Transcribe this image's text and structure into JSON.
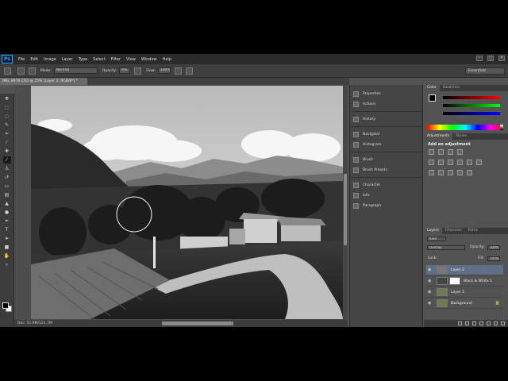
{
  "menubar": {
    "logo": "Ps",
    "items": [
      "File",
      "Edit",
      "Image",
      "Layer",
      "Type",
      "Select",
      "Filter",
      "View",
      "Window",
      "Help"
    ]
  },
  "options": {
    "mode_label": "Mode:",
    "mode_value": "Normal",
    "opacity_label": "Opacity:",
    "opacity_value": "6%",
    "flow_label": "Flow:",
    "flow_value": "100%",
    "workspace": "Essentials"
  },
  "document": {
    "tab_title": "IMG_8976.CR2 @ 25% (Layer 2, RGB/8*) *",
    "status": "Doc: 51.9M/121.7M"
  },
  "tools": [
    "move-icon",
    "marquee-icon",
    "lasso-icon",
    "quick-select-icon",
    "crop-icon",
    "eyedropper-icon",
    "healing-icon",
    "brush-icon",
    "clone-icon",
    "history-brush-icon",
    "eraser-icon",
    "gradient-icon",
    "blur-icon",
    "dodge-icon",
    "pen-icon",
    "type-icon",
    "path-select-icon",
    "shape-icon",
    "hand-icon",
    "zoom-icon"
  ],
  "collapsed_panels": {
    "group1": [
      "Properties",
      "Actions"
    ],
    "group2": [
      "History"
    ],
    "group3": [
      "Navigator",
      "Histogram"
    ],
    "group4": [
      "Brush",
      "Brush Presets"
    ],
    "group5": [
      "Character",
      "Info",
      "Paragraph"
    ]
  },
  "color_panel": {
    "tabs": [
      "Color",
      "Swatches"
    ]
  },
  "adjustments_panel": {
    "tabs": [
      "Adjustments",
      "Styles"
    ],
    "title": "Add an adjustment"
  },
  "layers_panel": {
    "tabs": [
      "Layers",
      "Channels",
      "Paths"
    ],
    "filter": "Kind",
    "blend_mode": "Overlay",
    "opacity_label": "Opacity:",
    "opacity_value": "100%",
    "lock_label": "Lock:",
    "fill_label": "Fill:",
    "fill_value": "100%",
    "layers": [
      {
        "name": "Layer 2",
        "selected": true
      },
      {
        "name": "Black & White 1",
        "selected": false
      },
      {
        "name": "Layer 1",
        "selected": false
      },
      {
        "name": "Background",
        "selected": false
      }
    ]
  }
}
